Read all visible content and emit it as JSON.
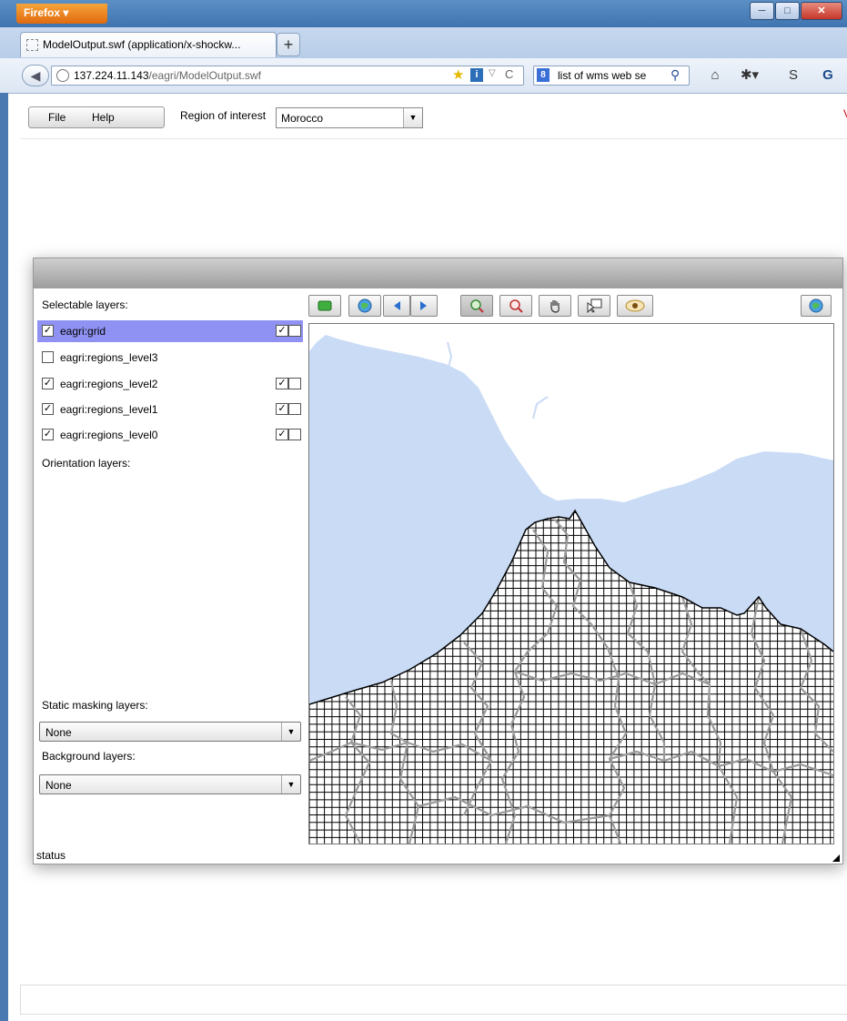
{
  "browser": {
    "app_button": "Firefox ▾",
    "window_controls": [
      "─",
      "□",
      "✕"
    ],
    "tab_title": "ModelOutput.swf (application/x-shockw...",
    "new_tab": "+",
    "back": "◀",
    "url_host": "137.224.11.143",
    "url_path": "/eagri/ModelOutput.swf",
    "url_info": "i",
    "url_dropdown": "▽",
    "url_reload": "C",
    "star": "★",
    "search_engine": "8",
    "search_text": "list of wms web se",
    "search_go": "⚲",
    "nav_icons": {
      "home": "⌂",
      "addon": "✱▾",
      "s_ext": "S",
      "gm_ext": "G"
    }
  },
  "app": {
    "menu": {
      "file": "File",
      "help": "Help"
    },
    "region_label": "Region of interest",
    "region_value": "Morocco",
    "right_mark": "V"
  },
  "panel": {
    "selectable_title": "Selectable layers:",
    "layers": [
      {
        "name": "eagri:grid",
        "checked": true,
        "selected": true,
        "has_toggle": true
      },
      {
        "name": "eagri:regions_level3",
        "checked": false,
        "selected": false,
        "has_toggle": false
      },
      {
        "name": "eagri:regions_level2",
        "checked": true,
        "selected": false,
        "has_toggle": true
      },
      {
        "name": "eagri:regions_level1",
        "checked": true,
        "selected": false,
        "has_toggle": true
      },
      {
        "name": "eagri:regions_level0",
        "checked": true,
        "selected": false,
        "has_toggle": true
      }
    ],
    "check_mark": "✓",
    "orientation_title": "Orientation layers:",
    "static_masking_title": "Static masking layers:",
    "static_masking_value": "None",
    "background_title": "Background layers:",
    "background_value": "None",
    "dropdown_arrow": "▼",
    "status": "status"
  },
  "toolbar": {
    "icons": [
      "layers-icon",
      "globe-icon",
      "back-arrow-icon",
      "forward-arrow-icon",
      "zoom-in-icon",
      "zoom-out-icon",
      "pan-hand-icon",
      "identify-icon",
      "eye-icon",
      "refresh-globe-icon"
    ]
  },
  "colors": {
    "sea": "#c9dbf5",
    "grid_line": "#000000",
    "region_border": "#9a9a9a",
    "selection": "#8f92f2"
  }
}
